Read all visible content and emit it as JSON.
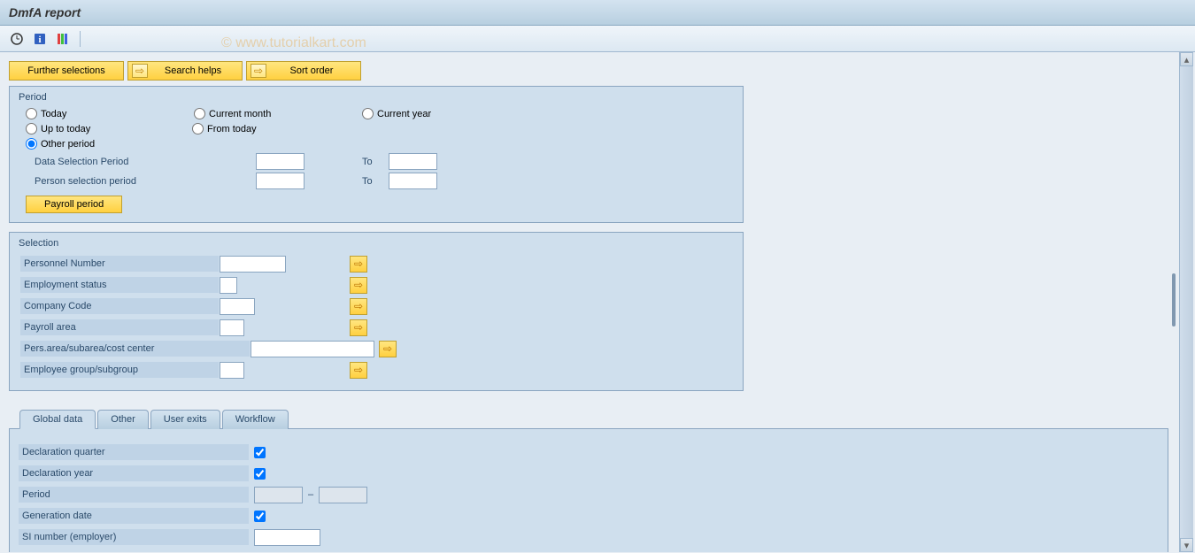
{
  "title": "DmfA report",
  "watermark": "© www.tutorialkart.com",
  "top_buttons": {
    "further": "Further selections",
    "search": "Search helps",
    "sort": "Sort order"
  },
  "period": {
    "title": "Period",
    "radios": {
      "today": "Today",
      "current_month": "Current month",
      "current_year": "Current year",
      "up_to_today": "Up to today",
      "from_today": "From today",
      "other_period": "Other period"
    },
    "data_sel": "Data Selection Period",
    "person_sel": "Person selection period",
    "to": "To",
    "payroll_btn": "Payroll period"
  },
  "selection": {
    "title": "Selection",
    "personnel": "Personnel Number",
    "employment": "Employment status",
    "company": "Company Code",
    "payroll_area": "Payroll area",
    "pers_area": "Pers.area/subarea/cost center",
    "emp_group": "Employee group/subgroup"
  },
  "tabs": {
    "global": "Global data",
    "other": "Other",
    "user_exits": "User exits",
    "workflow": "Workflow"
  },
  "global_data": {
    "decl_quarter": "Declaration quarter",
    "decl_year": "Declaration year",
    "period": "Period",
    "gen_date": "Generation date",
    "si_number": "SI number (employer)"
  }
}
